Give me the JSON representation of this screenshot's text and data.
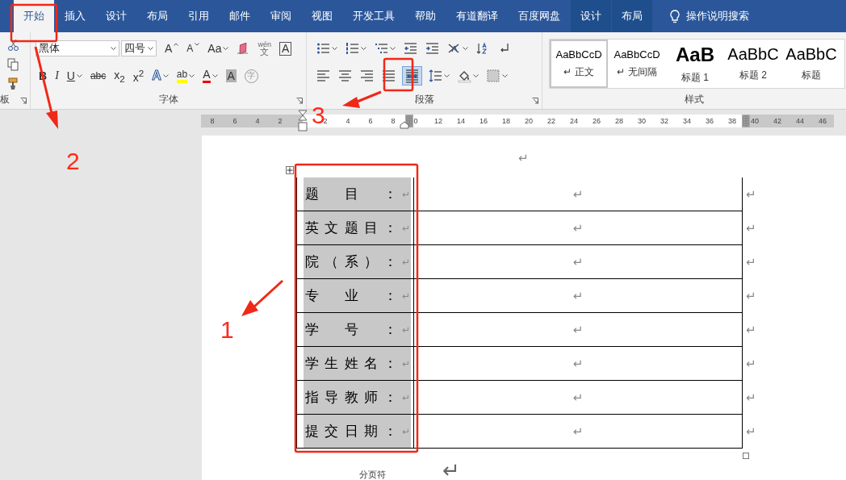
{
  "tabs": [
    {
      "label": "开始",
      "selected": true,
      "kind": "main"
    },
    {
      "label": "插入",
      "selected": false,
      "kind": "main"
    },
    {
      "label": "设计",
      "selected": false,
      "kind": "main"
    },
    {
      "label": "布局",
      "selected": false,
      "kind": "main"
    },
    {
      "label": "引用",
      "selected": false,
      "kind": "main"
    },
    {
      "label": "邮件",
      "selected": false,
      "kind": "main"
    },
    {
      "label": "审阅",
      "selected": false,
      "kind": "main"
    },
    {
      "label": "视图",
      "selected": false,
      "kind": "main"
    },
    {
      "label": "开发工具",
      "selected": false,
      "kind": "main"
    },
    {
      "label": "帮助",
      "selected": false,
      "kind": "main"
    },
    {
      "label": "有道翻译",
      "selected": false,
      "kind": "main"
    },
    {
      "label": "百度网盘",
      "selected": false,
      "kind": "main"
    },
    {
      "label": "设计",
      "selected": false,
      "kind": "context"
    },
    {
      "label": "布局",
      "selected": false,
      "kind": "context"
    }
  ],
  "search": {
    "label": "操作说明搜索"
  },
  "clipboard": {
    "label": "板"
  },
  "font": {
    "label": "字体",
    "name": "黑体",
    "size": "四号",
    "row1": [
      {
        "kind": "grow",
        "label": "A",
        "dropdown": false
      },
      {
        "kind": "shrink",
        "label": "A",
        "dropdown": false
      },
      {
        "kind": "case",
        "label": "Aa",
        "dropdown": true
      },
      {
        "kind": "clear",
        "dropdown": false
      },
      {
        "kind": "phonetic",
        "top": "wén",
        "label": "文",
        "dropdown": false
      },
      {
        "kind": "boxed",
        "label": "A",
        "dropdown": false
      }
    ],
    "row2": [
      {
        "kind": "bold",
        "label": "B",
        "dropdown": false
      },
      {
        "kind": "italic",
        "label": "I",
        "dropdown": false
      },
      {
        "kind": "underline",
        "label": "U",
        "dropdown": true
      },
      {
        "kind": "strike",
        "label": "abc",
        "dropdown": false
      },
      {
        "kind": "plain",
        "label": "x$_{2}$",
        "dropdown": false
      },
      {
        "kind": "plain",
        "label": "x$^{2}$",
        "dropdown": false
      },
      {
        "kind": "effects",
        "label": "A",
        "dropdown": true
      },
      {
        "kind": "highlight",
        "label": "ab",
        "dropdown": true
      },
      {
        "kind": "color",
        "label": "A",
        "dropdown": true
      },
      {
        "kind": "shaded",
        "label": "A",
        "dropdown": false
      },
      {
        "kind": "enclosed",
        "label": "字",
        "dropdown": false
      }
    ]
  },
  "paragraph": {
    "label": "段落",
    "row1": [
      {
        "kind": "bullets",
        "dropdown": true,
        "selected": false
      },
      {
        "kind": "numbering",
        "dropdown": true,
        "selected": false
      },
      {
        "kind": "multilevel",
        "dropdown": true,
        "selected": false
      },
      {
        "kind": "outdent",
        "dropdown": false,
        "selected": false
      },
      {
        "kind": "indent",
        "dropdown": false,
        "selected": false
      },
      {
        "kind": "layout",
        "dropdown": true,
        "selected": false
      },
      {
        "kind": "sort",
        "dropdown": false,
        "selected": false
      },
      {
        "kind": "marks",
        "dropdown": false,
        "selected": false
      }
    ],
    "row2": [
      {
        "kind": "left",
        "dropdown": false,
        "selected": false
      },
      {
        "kind": "center",
        "dropdown": false,
        "selected": false
      },
      {
        "kind": "right",
        "dropdown": false,
        "selected": false
      },
      {
        "kind": "justify",
        "dropdown": false,
        "selected": false
      },
      {
        "kind": "distributed",
        "dropdown": false,
        "selected": true
      },
      {
        "kind": "spacing",
        "dropdown": true,
        "selected": false
      },
      {
        "kind": "shading",
        "dropdown": true,
        "selected": false
      },
      {
        "kind": "borders",
        "dropdown": true,
        "selected": false
      }
    ]
  },
  "styles": {
    "label": "样式",
    "items": [
      {
        "preview": "AaBbCcD",
        "name": "正文",
        "mark": "↵",
        "kind": "body",
        "selected": true
      },
      {
        "preview": "AaBbCcD",
        "name": "无间隔",
        "mark": "↵",
        "kind": "body",
        "selected": false
      },
      {
        "preview": "AaB",
        "name": "标题 1",
        "kind": "h1",
        "selected": false
      },
      {
        "preview": "AaBbC",
        "name": "标题 2",
        "kind": "h2",
        "selected": false
      },
      {
        "preview": "AaBbC",
        "name": "标题",
        "kind": "title",
        "selected": false
      }
    ]
  },
  "ruler": {
    "ticks": [
      {
        "kind": "margin",
        "label": "8"
      },
      {
        "kind": "margin",
        "label": "6"
      },
      {
        "kind": "margin",
        "label": "4"
      },
      {
        "kind": "margin",
        "label": "2"
      },
      {
        "kind": "indent"
      },
      {
        "kind": "text",
        "label": "2"
      },
      {
        "kind": "text",
        "label": "4"
      },
      {
        "kind": "text",
        "label": "6"
      },
      {
        "kind": "text",
        "label": "8"
      },
      {
        "kind": "column"
      },
      {
        "kind": "text",
        "label": "0"
      },
      {
        "kind": "text",
        "label": "12"
      },
      {
        "kind": "text",
        "label": "14"
      },
      {
        "kind": "text",
        "label": "16"
      },
      {
        "kind": "text",
        "label": "18"
      },
      {
        "kind": "text",
        "label": "20"
      },
      {
        "kind": "text",
        "label": "22"
      },
      {
        "kind": "text",
        "label": "24"
      },
      {
        "kind": "text",
        "label": "26"
      },
      {
        "kind": "text",
        "label": "28"
      },
      {
        "kind": "text",
        "label": "30"
      },
      {
        "kind": "text",
        "label": "32"
      },
      {
        "kind": "text",
        "label": "34"
      },
      {
        "kind": "text",
        "label": "36"
      },
      {
        "kind": "text",
        "label": "38"
      },
      {
        "kind": "end"
      },
      {
        "kind": "margin",
        "label": "40"
      },
      {
        "kind": "margin",
        "label": "42"
      },
      {
        "kind": "margin",
        "label": "44"
      },
      {
        "kind": "margin",
        "label": "46"
      }
    ]
  },
  "document": {
    "top_mark": "↵",
    "table": {
      "column_selected": true,
      "rows": [
        {
          "label": "题目：",
          "label_mark": "↵",
          "value": "↵",
          "end_mark": "↵"
        },
        {
          "label": "英文题目：",
          "label_mark": "↵",
          "value": "↵",
          "end_mark": "↵"
        },
        {
          "label": "院（系）：",
          "label_mark": "↵",
          "value": "↵",
          "end_mark": "↵"
        },
        {
          "label": "专业：",
          "label_mark": "↵",
          "value": "↵",
          "end_mark": "↵"
        },
        {
          "label": "学号：",
          "label_mark": "↵",
          "value": "↵",
          "end_mark": "↵"
        },
        {
          "label": "学生姓名：",
          "label_mark": "↵",
          "value": "↵",
          "end_mark": "↵"
        },
        {
          "label": "指导教师：",
          "label_mark": "↵",
          "value": "↵",
          "end_mark": "↵"
        },
        {
          "label": "提交日期：",
          "label_mark": "↵",
          "value": "↵",
          "end_mark": "↵"
        }
      ]
    },
    "page_break": "分页符",
    "bottom_mark": "↵"
  },
  "annotations": [
    {
      "label": "1"
    },
    {
      "label": "2"
    },
    {
      "label": "3"
    }
  ]
}
